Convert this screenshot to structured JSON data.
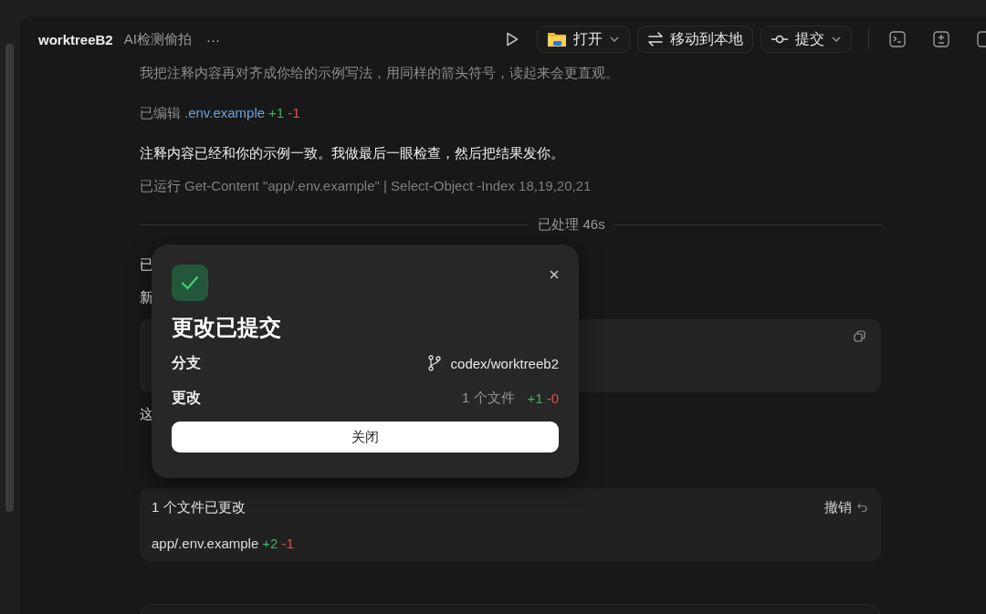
{
  "header": {
    "title": "worktreeB2",
    "subtitle": "AI检测偷拍",
    "more": "···",
    "buttons": [
      {
        "kind": "open",
        "label": "打开",
        "caret": true
      },
      {
        "kind": "move",
        "label": "移动到本地",
        "caret": false
      },
      {
        "kind": "commit",
        "label": "提交",
        "caret": true
      }
    ]
  },
  "messages": [
    {
      "kind": "status",
      "text": "我把注释内容再对齐成你给的示例写法，用同样的箭头符号，读起来会更直观。"
    },
    {
      "kind": "edited",
      "label": "已编辑",
      "file": ".env.example",
      "added": "+1",
      "removed": "-1"
    },
    {
      "kind": "reply",
      "text": "注释内容已经和你的示例一致。我做最后一眼检查，然后把结果发你。"
    },
    {
      "kind": "ran",
      "label": "已运行",
      "command": "Get-Content \"app/.env.example\" | Select-Object -Index 18,19,20,21"
    },
    {
      "kind": "divider",
      "text": "已处理 46s"
    },
    {
      "kind": "reply",
      "text": "已"
    },
    {
      "kind": "reply",
      "text": "新"
    },
    {
      "kind": "code"
    },
    {
      "kind": "reply",
      "text": "这"
    },
    {
      "kind": "changes",
      "title": "1 个文件已更改",
      "undo": "撤销",
      "files": [
        {
          "path": "app/.env.example",
          "added": "+2",
          "removed": "-1"
        }
      ]
    },
    {
      "kind": "composer"
    }
  ],
  "dialog": {
    "title": "更改已提交",
    "rows": [
      {
        "kind": "branch",
        "label": "分支",
        "value": "codex/worktreeb2"
      },
      {
        "kind": "diff",
        "label": "更改",
        "value": "1 个文件",
        "added": "+1",
        "removed": "-0"
      }
    ],
    "button": "关闭"
  }
}
